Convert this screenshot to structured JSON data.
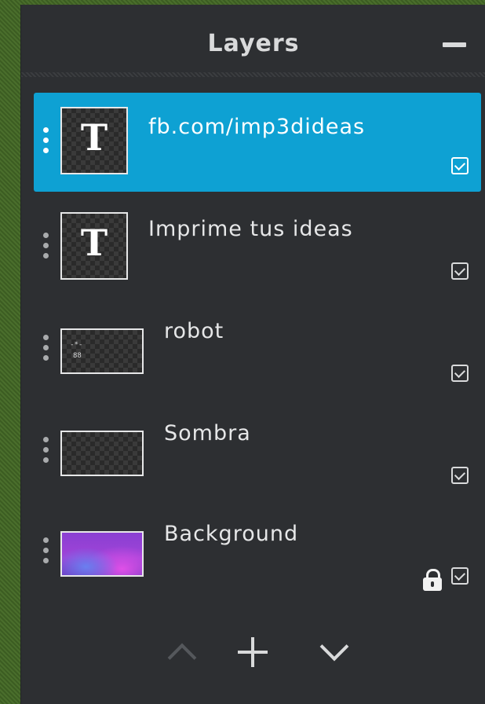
{
  "panel": {
    "title": "Layers"
  },
  "layers": [
    {
      "name": "fb.com/imp3dideas",
      "thumb_type": "text",
      "thumb_glyph": "T",
      "selected": true,
      "visible": true,
      "locked": false
    },
    {
      "name": "Imprime tus ideas",
      "thumb_type": "text",
      "thumb_glyph": "T",
      "selected": false,
      "visible": true,
      "locked": false
    },
    {
      "name": "robot",
      "thumb_type": "image",
      "selected": false,
      "visible": true,
      "locked": false
    },
    {
      "name": "Sombra",
      "thumb_type": "image",
      "selected": false,
      "visible": true,
      "locked": false
    },
    {
      "name": "Background",
      "thumb_type": "image",
      "selected": false,
      "visible": true,
      "locked": true
    }
  ],
  "toolbar": {
    "move_up_icon": "chevron-up-icon",
    "add_icon": "plus-icon",
    "move_down_icon": "chevron-down-icon"
  },
  "colors": {
    "panel_bg": "#2d2f32",
    "selection": "#0ea1d3",
    "text": "#e6e7e8"
  }
}
